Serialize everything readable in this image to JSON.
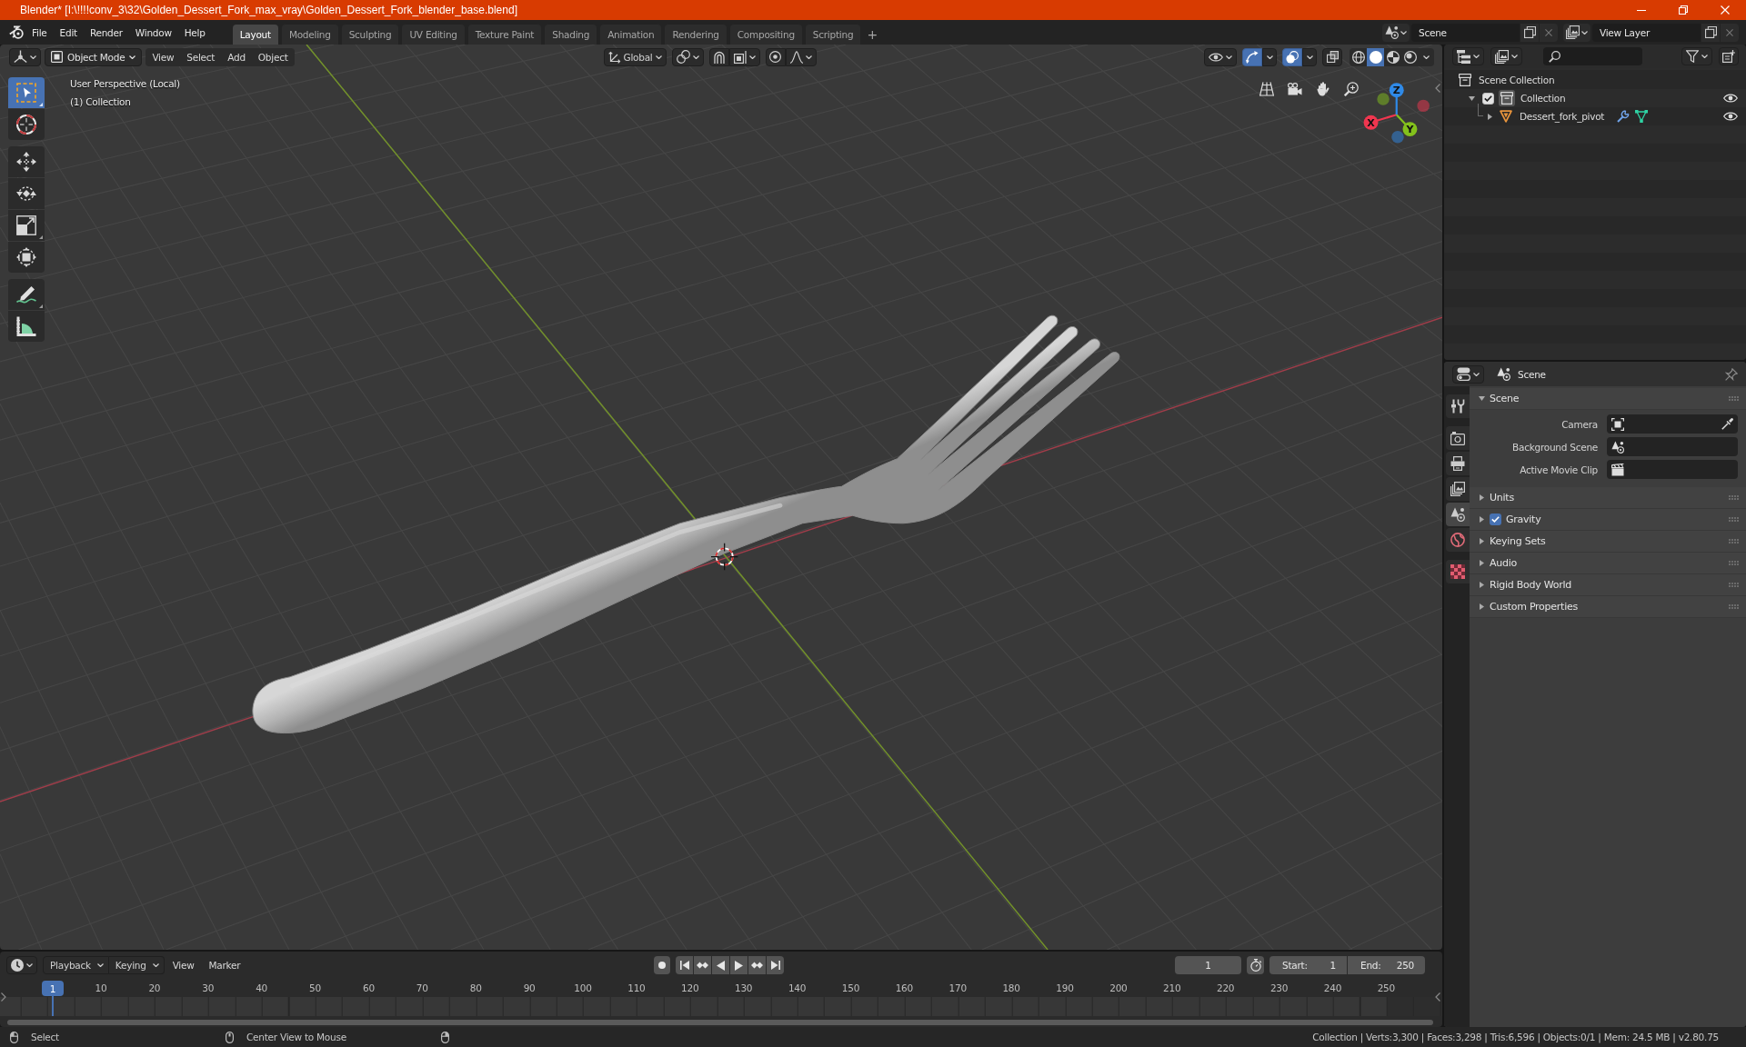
{
  "window": {
    "title": "Blender* [I:\\!!!!conv_3\\32\\Golden_Dessert_Fork_max_vray\\Golden_Dessert_Fork_blender_base.blend]"
  },
  "menu_bar": [
    "File",
    "Edit",
    "Render",
    "Window",
    "Help"
  ],
  "workspace_tabs": [
    {
      "label": "Layout",
      "selected": true
    },
    {
      "label": "Modeling",
      "selected": false
    },
    {
      "label": "Sculpting",
      "selected": false
    },
    {
      "label": "UV Editing",
      "selected": false
    },
    {
      "label": "Texture Paint",
      "selected": false
    },
    {
      "label": "Shading",
      "selected": false
    },
    {
      "label": "Animation",
      "selected": false
    },
    {
      "label": "Rendering",
      "selected": false
    },
    {
      "label": "Compositing",
      "selected": false
    },
    {
      "label": "Scripting",
      "selected": false
    }
  ],
  "add_workspace": "+",
  "scene_selector": {
    "value": "Scene"
  },
  "view_layer_selector": {
    "value": "View Layer"
  },
  "viewport": {
    "header": {
      "mode": "Object Mode",
      "menus": [
        "View",
        "Select",
        "Add",
        "Object"
      ],
      "orientation": "Global",
      "show_gizmos": true,
      "show_overlays": true,
      "xray": false,
      "shading_modes": [
        {
          "kind": "wireframe",
          "selected": false
        },
        {
          "kind": "solid",
          "selected": true
        },
        {
          "kind": "material",
          "selected": false
        },
        {
          "kind": "rendered",
          "selected": false
        }
      ]
    },
    "info": [
      "User Perspective (Local)",
      "(1) Collection"
    ],
    "tool_groups": [
      [
        {
          "kind": "select_box",
          "selected": true,
          "has_variants": true
        },
        {
          "kind": "cursor",
          "selected": false,
          "has_variants": false
        }
      ],
      [
        {
          "kind": "move",
          "selected": false,
          "has_variants": false
        },
        {
          "kind": "rotate",
          "selected": false,
          "has_variants": false
        },
        {
          "kind": "scale",
          "selected": false,
          "has_variants": true
        },
        {
          "kind": "transform",
          "selected": false,
          "has_variants": false
        }
      ],
      [
        {
          "kind": "annotate",
          "selected": false,
          "has_variants": true
        },
        {
          "kind": "measure",
          "selected": false,
          "has_variants": false
        }
      ]
    ],
    "navigation_gizmo": {
      "axes": [
        {
          "label": "X",
          "color": "#f0364f"
        },
        {
          "label": "Y",
          "color": "#83c11c"
        },
        {
          "label": "Z",
          "color": "#2f8ae8"
        }
      ]
    }
  },
  "outliner": {
    "tree": [
      {
        "label": "Scene Collection",
        "kind": "scene_collection",
        "active": false,
        "children": [
          {
            "label": "Collection",
            "kind": "collection",
            "active": true,
            "expanded": true,
            "checked": true,
            "visible": true,
            "children": [
              {
                "label": "Dessert_fork_pivot",
                "kind": "object",
                "active": false,
                "expanded": false,
                "visible": true
              }
            ]
          }
        ]
      }
    ]
  },
  "properties": {
    "context": "Scene",
    "tab_groups": [
      [
        {
          "kind": "tool",
          "selected": false
        }
      ],
      [
        {
          "kind": "render",
          "selected": false
        },
        {
          "kind": "output",
          "selected": false
        },
        {
          "kind": "view_layer",
          "selected": false
        },
        {
          "kind": "scene",
          "selected": true
        },
        {
          "kind": "world",
          "selected": false
        }
      ],
      [
        {
          "kind": "texture",
          "selected": false
        }
      ]
    ],
    "panels": [
      {
        "label": "Scene",
        "kind": "plain",
        "expanded": true,
        "fields": [
          {
            "label": "Camera",
            "kind": "camera"
          },
          {
            "label": "Background Scene",
            "kind": "scene"
          },
          {
            "label": "Active Movie Clip",
            "kind": "movie_clip"
          }
        ]
      },
      {
        "label": "Units",
        "kind": "plain",
        "expanded": false
      },
      {
        "label": "Gravity",
        "kind": "toggle",
        "expanded": false,
        "checked": true
      },
      {
        "label": "Keying Sets",
        "kind": "plain",
        "expanded": false
      },
      {
        "label": "Audio",
        "kind": "plain",
        "expanded": false
      },
      {
        "label": "Rigid Body World",
        "kind": "plain",
        "expanded": false
      },
      {
        "label": "Custom Properties",
        "kind": "plain",
        "expanded": false
      }
    ]
  },
  "timeline": {
    "menus": [
      {
        "label": "Playback",
        "kind": "dropdown"
      },
      {
        "label": "Keying",
        "kind": "dropdown"
      },
      {
        "label": "View",
        "kind": "menu"
      },
      {
        "label": "Marker",
        "kind": "menu"
      }
    ],
    "playhead": "1",
    "current_frame": "1",
    "start": {
      "label": "Start:",
      "value": "1"
    },
    "end": {
      "label": "End:",
      "value": "250"
    },
    "ruler": [
      "10",
      "20",
      "30",
      "40",
      "50",
      "60",
      "70",
      "80",
      "90",
      "100",
      "110",
      "120",
      "130",
      "140",
      "150",
      "160",
      "170",
      "180",
      "190",
      "200",
      "210",
      "220",
      "230",
      "240",
      "250"
    ]
  },
  "status_bar": {
    "hints": [
      "Select",
      "Center View to Mouse"
    ],
    "stats": "Collection | Verts:3,300 | Faces:3,298 | Tris:6,596 | Objects:0/1 | Mem: 24.5 MB | v2.80.75"
  }
}
